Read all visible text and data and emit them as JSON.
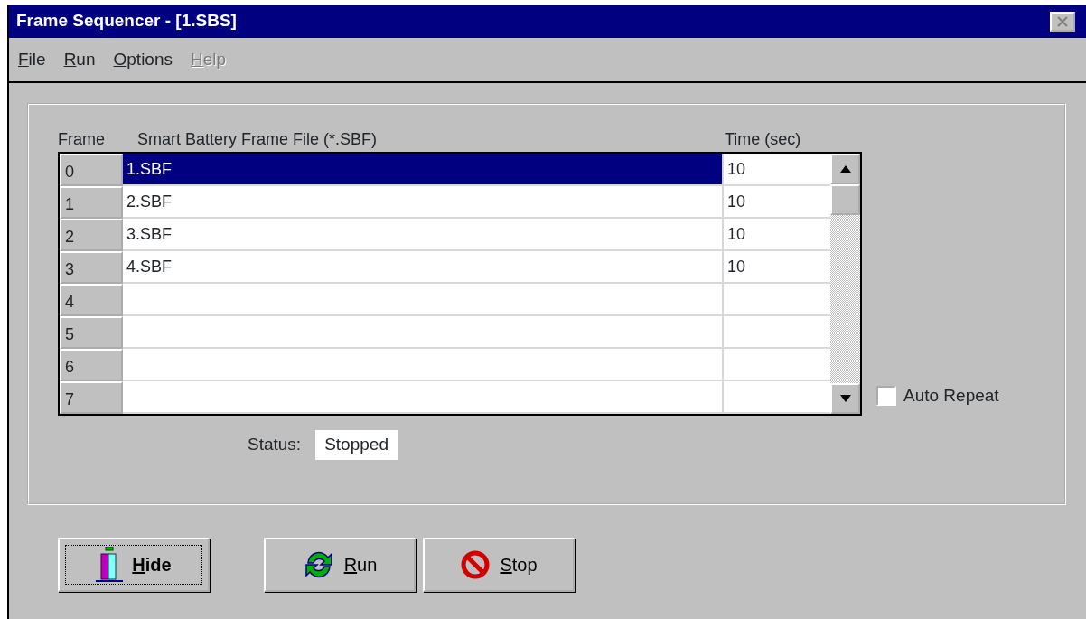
{
  "window": {
    "title": "Frame Sequencer - [1.SBS]"
  },
  "menu": [
    {
      "label": "File",
      "disabled": false
    },
    {
      "label": "Run",
      "disabled": false
    },
    {
      "label": "Options",
      "disabled": false
    },
    {
      "label": "Help",
      "disabled": true
    }
  ],
  "table": {
    "columns": [
      "Frame",
      "Smart Battery Frame File (*.SBF)",
      "Time (sec)"
    ],
    "rows": [
      {
        "frame": "0",
        "file": "1.SBF",
        "time": "10",
        "selected": true
      },
      {
        "frame": "1",
        "file": "2.SBF",
        "time": "10",
        "selected": false
      },
      {
        "frame": "2",
        "file": "3.SBF",
        "time": "10",
        "selected": false
      },
      {
        "frame": "3",
        "file": "4.SBF",
        "time": "10",
        "selected": false
      },
      {
        "frame": "4",
        "selected": false
      },
      {
        "frame": "5",
        "selected": false
      },
      {
        "frame": "6",
        "selected": false
      },
      {
        "frame": "7",
        "selected": false
      }
    ]
  },
  "auto_repeat": {
    "label": "Auto Repeat",
    "checked": false
  },
  "status": {
    "label": "Status:",
    "value": "Stopped"
  },
  "buttons": [
    {
      "label": "Hide",
      "kind": "hide",
      "focused": true
    },
    {
      "label": "Run",
      "kind": "run",
      "focused": false
    },
    {
      "label": "Stop",
      "kind": "stop",
      "focused": false
    }
  ]
}
